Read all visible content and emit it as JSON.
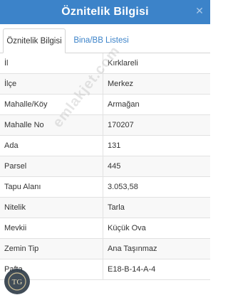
{
  "header": {
    "title": "Öznitelik Bilgisi",
    "close_icon": "close-icon"
  },
  "tabs": [
    {
      "label": "Öznitelik Bilgisi",
      "active": true
    },
    {
      "label": "Bina/BB Listesi",
      "active": false
    }
  ],
  "rows": [
    {
      "label": "İl",
      "value": "Kırklareli"
    },
    {
      "label": "İlçe",
      "value": "Merkez"
    },
    {
      "label": "Mahalle/Köy",
      "value": "Armağan"
    },
    {
      "label": "Mahalle No",
      "value": "170207"
    },
    {
      "label": "Ada",
      "value": "131"
    },
    {
      "label": "Parsel",
      "value": "445"
    },
    {
      "label": "Tapu Alanı",
      "value": "3.053,58"
    },
    {
      "label": "Nitelik",
      "value": "Tarla"
    },
    {
      "label": "Mevkii",
      "value": "Küçük Ova"
    },
    {
      "label": "Zemin Tip",
      "value": "Ana Taşınmaz"
    },
    {
      "label": "Pafta",
      "value": "E18-B-14-A-4"
    }
  ],
  "watermark": {
    "text": "emlakjet.com"
  },
  "colors": {
    "header_bg": "#3c83c9",
    "tab_active_text": "#333333",
    "tab_inactive_text": "#3c83c9"
  }
}
